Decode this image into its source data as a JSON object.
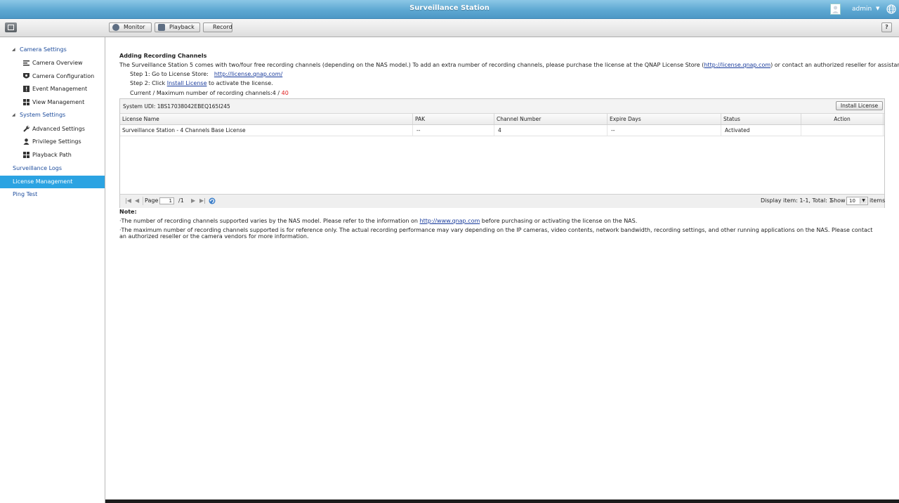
{
  "app": {
    "title": "Surveillance Station",
    "user": "admin"
  },
  "toolbar": {
    "monitor": "Monitor",
    "playback": "Playback",
    "record": "Record",
    "help": "?"
  },
  "sidebar": {
    "camera_settings": "Camera Settings",
    "camera_overview": "Camera Overview",
    "camera_configuration": "Camera Configuration",
    "event_management": "Event Management",
    "view_management": "View Management",
    "system_settings": "System Settings",
    "advanced_settings": "Advanced Settings",
    "privilege_settings": "Privilege Settings",
    "playback_path": "Playback Path",
    "surveillance_logs": "Surveillance Logs",
    "license_management": "License Management",
    "ping_test": "Ping Test"
  },
  "main": {
    "title": "Adding Recording Channels",
    "intro_a": "The Surveillance Station 5 comes with two/four free recording channels (depending on the NAS model.) To add an extra number of recording channels, please purchase the license at the QNAP License Store (",
    "intro_link": "http://license.qnap.com",
    "intro_b": ") or contact an authorized reseller for assistance.",
    "step1": "Step 1: Go to License Store:",
    "step1_link": "http://license.qnap.com/",
    "step2_a": "Step 2: Click ",
    "step2_link": "Install License",
    "step2_b": " to activate the license.",
    "channels_label": "Current / Maximum number of recording channels:4 / ",
    "channels_max": "40"
  },
  "panel": {
    "udi": "System UDI: 1BS17038042EBEQ165I245",
    "install_button": "Install License",
    "columns": [
      "License Name",
      "PAK",
      "Channel Number",
      "Expire Days",
      "Status",
      "Action"
    ],
    "rows": [
      [
        "Surveillance Station - 4 Channels Base License",
        "--",
        "4",
        "--",
        "Activated",
        ""
      ]
    ]
  },
  "pager": {
    "page_label": "Page",
    "page_value": "1",
    "total_pages": "/1",
    "display": "Display item: 1-1, Total: 1",
    "show_label": "Show",
    "show_value": "10",
    "items_label": "items"
  },
  "notes": {
    "title": "Note:",
    "note1_a": "·The number of recording channels supported varies by the NAS model. Please refer to the information on ",
    "note1_link": "http://www.qnap.com",
    "note1_b": " before purchasing or activating the license on the NAS.",
    "note2": "·The maximum number of recording channels supported is for reference only. The actual recording performance may vary depending on the IP cameras, video contents, network bandwidth, recording settings, and other running applications on the NAS. Please contact an authorized reseller or the camera vendors for more information."
  },
  "colors": {
    "accent": "#2ba3e2",
    "titlebar": "#5ea8d2",
    "link": "#1a3c9c",
    "max_channels": "#e02020"
  }
}
